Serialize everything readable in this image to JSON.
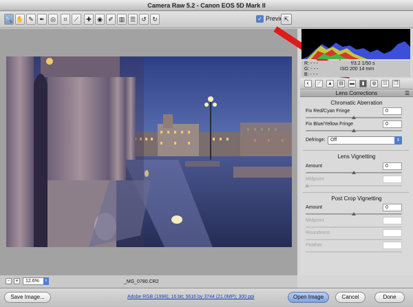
{
  "window": {
    "title": "Camera Raw 5.2  -  Canon EOS 5D Mark II"
  },
  "toolbar": {
    "tools": [
      {
        "name": "zoom-tool",
        "glyph": "🔍",
        "selected": true
      },
      {
        "name": "hand-tool",
        "glyph": "✋",
        "selected": false
      },
      {
        "name": "white-balance-tool",
        "glyph": "✎",
        "selected": false
      },
      {
        "name": "color-sampler-tool",
        "glyph": "✒",
        "selected": false
      },
      {
        "name": "targeted-adjustment-tool",
        "glyph": "◎",
        "selected": false
      },
      {
        "name": "crop-tool",
        "glyph": "⌗",
        "selected": false
      },
      {
        "name": "straighten-tool",
        "glyph": "⟋",
        "selected": false
      },
      {
        "name": "spot-removal-tool",
        "glyph": "✚",
        "selected": false
      },
      {
        "name": "red-eye-tool",
        "glyph": "◉",
        "selected": false
      },
      {
        "name": "adjustment-brush-tool",
        "glyph": "✐",
        "selected": false
      },
      {
        "name": "graduated-filter-tool",
        "glyph": "▥",
        "selected": false
      },
      {
        "name": "preferences-tool",
        "glyph": "☰",
        "selected": false
      },
      {
        "name": "rotate-left-tool",
        "glyph": "↺",
        "selected": false
      },
      {
        "name": "rotate-right-tool",
        "glyph": "↻",
        "selected": false
      }
    ],
    "preview_label": "Preview",
    "preview_checked": true
  },
  "readout": {
    "r": "R:  - - -",
    "g": "G:  - - -",
    "b": "B:  - - -",
    "exposure": "f/3.2   1/50 s",
    "iso": "ISO 200   14 mm"
  },
  "tabs": [
    "basic-tab",
    "tone-curve-tab",
    "detail-tab",
    "hsl-tab",
    "split-toning-tab",
    "lens-corrections-tab",
    "camera-calibration-tab",
    "presets-tab",
    "snapshots-tab"
  ],
  "active_tab_index": 5,
  "panel": {
    "title": "Lens Corrections",
    "chromatic": {
      "title": "Chromatic Aberration",
      "fix_red_cyan": {
        "label": "Fix Red/Cyan Fringe",
        "value": "0"
      },
      "fix_blue_yellow": {
        "label": "Fix Blue/Yellow Fringe",
        "value": "0"
      },
      "defringe": {
        "label": "Defringe:",
        "value": "Off"
      }
    },
    "vignetting": {
      "title": "Lens Vignetting",
      "amount": {
        "label": "Amount",
        "value": "0"
      },
      "midpoint": {
        "label": "Midpoint",
        "value": ""
      }
    },
    "post_crop": {
      "title": "Post Crop Vignetting",
      "amount": {
        "label": "Amount",
        "value": "0"
      },
      "midpoint": {
        "label": "Midpoint",
        "value": ""
      },
      "roundness": {
        "label": "Roundness",
        "value": ""
      },
      "feather": {
        "label": "Feather",
        "value": ""
      }
    }
  },
  "zoom": {
    "level": "12.6%",
    "minus": "-",
    "plus": "+"
  },
  "filename": "_MG_0780.CR2",
  "workflow_link": "Adobe RGB (1998); 16 bit; 5616 by 3744 (21.0MP); 300 ppi",
  "buttons": {
    "save_image": "Save Image...",
    "open_image": "Open Image",
    "cancel": "Cancel",
    "done": "Done"
  },
  "colors": {
    "accent": "#4d7fd1",
    "annotation_arrow": "#e01a1a"
  }
}
